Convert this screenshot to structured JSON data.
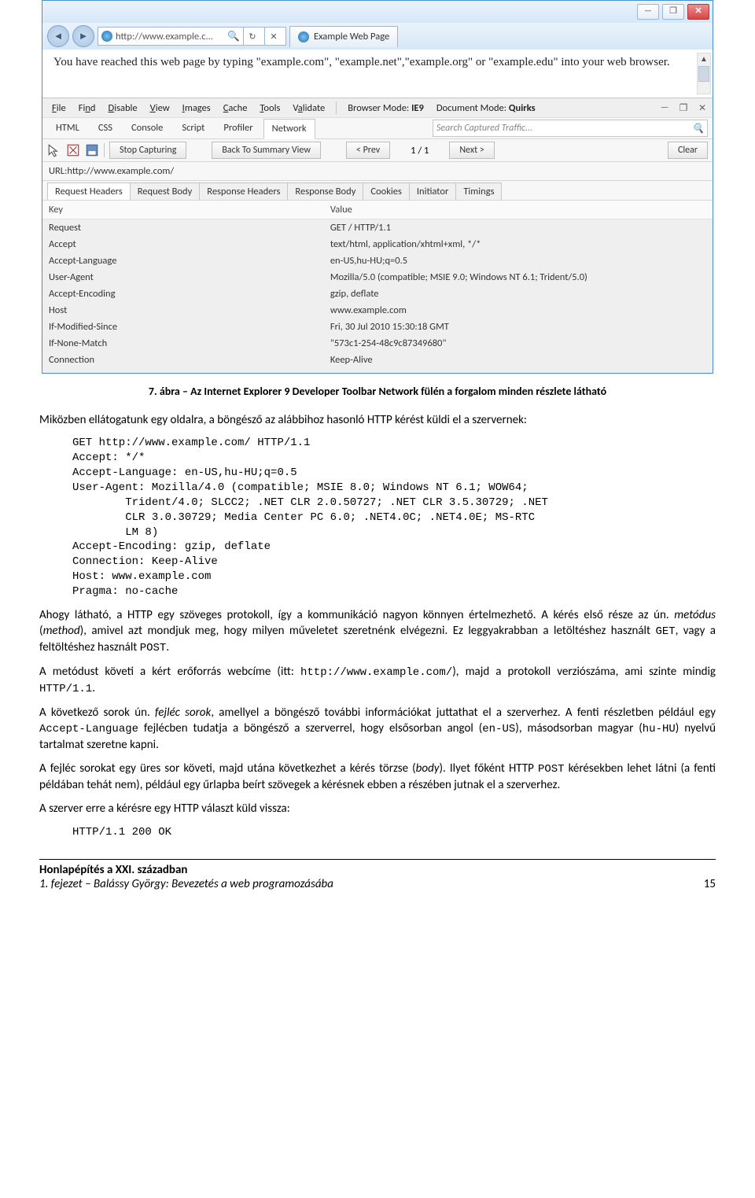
{
  "browser": {
    "address": "http://www.example.c...",
    "tab_title": "Example Web Page",
    "page_text": "You have reached this web page by typing \"example.com\", \"example.net\",\"example.org\" or \"example.edu\" into your web browser."
  },
  "window_controls": {
    "minimize": "—",
    "maximize": "❐",
    "close": "✕"
  },
  "dev": {
    "menu": [
      "File",
      "Find",
      "Disable",
      "View",
      "Images",
      "Cache",
      "Tools",
      "Validate"
    ],
    "browser_mode_label": "Browser Mode:",
    "browser_mode_value": "IE9",
    "document_mode_label": "Document Mode:",
    "document_mode_value": "Quirks",
    "tabs": [
      "HTML",
      "CSS",
      "Console",
      "Script",
      "Profiler",
      "Network"
    ],
    "active_tab": "Network",
    "search_placeholder": "Search Captured Traffic...",
    "buttons": {
      "stop": "Stop Capturing",
      "back_summary": "Back To Summary View",
      "prev": "< Prev",
      "count": "1 / 1",
      "next": "Next >",
      "clear": "Clear"
    },
    "url_label": "URL:",
    "url_value": "http://www.example.com/",
    "sub_tabs": [
      "Request Headers",
      "Request Body",
      "Response Headers",
      "Response Body",
      "Cookies",
      "Initiator",
      "Timings"
    ],
    "active_sub_tab": "Request Headers",
    "table": {
      "col_key": "Key",
      "col_value": "Value",
      "rows": [
        {
          "k": "Request",
          "v": "GET / HTTP/1.1"
        },
        {
          "k": "Accept",
          "v": "text/html, application/xhtml+xml, */*"
        },
        {
          "k": "Accept-Language",
          "v": "en-US,hu-HU;q=0.5"
        },
        {
          "k": "User-Agent",
          "v": "Mozilla/5.0 (compatible; MSIE 9.0; Windows NT 6.1; Trident/5.0)"
        },
        {
          "k": "Accept-Encoding",
          "v": "gzip, deflate"
        },
        {
          "k": "Host",
          "v": "www.example.com"
        },
        {
          "k": "If-Modified-Since",
          "v": "Fri, 30 Jul 2010 15:30:18 GMT"
        },
        {
          "k": "If-None-Match",
          "v": "\"573c1-254-48c9c87349680\""
        },
        {
          "k": "Connection",
          "v": "Keep-Alive"
        }
      ]
    }
  },
  "doc": {
    "caption": "7. ábra – Az Internet Explorer 9 Developer Toolbar Network fülén a forgalom minden részlete látható",
    "para1": "Miközben ellátogatunk egy oldalra, a böngésző az alábbihoz hasonló HTTP kérést küldi el a szervernek:",
    "code1": "GET http://www.example.com/ HTTP/1.1\nAccept: */*\nAccept-Language: en-US,hu-HU;q=0.5\nUser-Agent: Mozilla/4.0 (compatible; MSIE 8.0; Windows NT 6.1; WOW64;\n        Trident/4.0; SLCC2; .NET CLR 2.0.50727; .NET CLR 3.5.30729; .NET\n        CLR 3.0.30729; Media Center PC 6.0; .NET4.0C; .NET4.0E; MS-RTC\n        LM 8)\nAccept-Encoding: gzip, deflate\nConnection: Keep-Alive\nHost: www.example.com\nPragma: no-cache",
    "para2a": "Ahogy látható, a HTTP egy szöveges protokoll, így a kommunikáció nagyon könnyen értelmezhető. A kérés első része az ún. ",
    "para2b": "metódus",
    "para2c": " (",
    "para2d": "method",
    "para2e": "), amivel azt mondjuk meg, hogy milyen műveletet szeretnénk elvégezni. Ez leggyakrabban a letöltéshez használt ",
    "para2f": "GET",
    "para2g": ", vagy a feltöltéshez használt ",
    "para2h": "POST",
    "para2i": ".",
    "para3a": "A metódust követi a kért erőforrás webcíme (itt: ",
    "para3b": "http://www.example.com/",
    "para3c": "), majd a protokoll verziószáma, ami szinte mindig ",
    "para3d": "HTTP/1.1",
    "para3e": ".",
    "para4a": "A következő sorok ún. ",
    "para4b": "fejléc sorok",
    "para4c": ", amellyel a böngésző további információkat juttathat el a szerverhez. A fenti részletben például egy ",
    "para4d": "Accept-Language",
    "para4e": " fejlécben tudatja a böngésző a szerverrel, hogy elsősorban angol (",
    "para4f": "en-US",
    "para4g": "), másodsorban magyar (",
    "para4h": "hu-HU",
    "para4i": ") nyelvű tartalmat szeretne kapni.",
    "para5a": "A fejléc sorokat egy üres sor követi, majd utána következhet a kérés törzse (",
    "para5b": "body",
    "para5c": "). Ilyet főként HTTP ",
    "para5d": "POST",
    "para5e": " kérésekben lehet látni (a fenti példában tehát nem), például egy űrlapba beírt szövegek a kérésnek ebben a részében jutnak el a szerverhez.",
    "para6": "A szerver erre a kérésre egy HTTP választ küld vissza:",
    "code2": "HTTP/1.1 200 OK",
    "footer_title": "Honlapépítés a XXI. században",
    "footer_sub": "1.    fejezet – Balássy György: Bevezetés a web programozásába",
    "page_number": "15"
  }
}
